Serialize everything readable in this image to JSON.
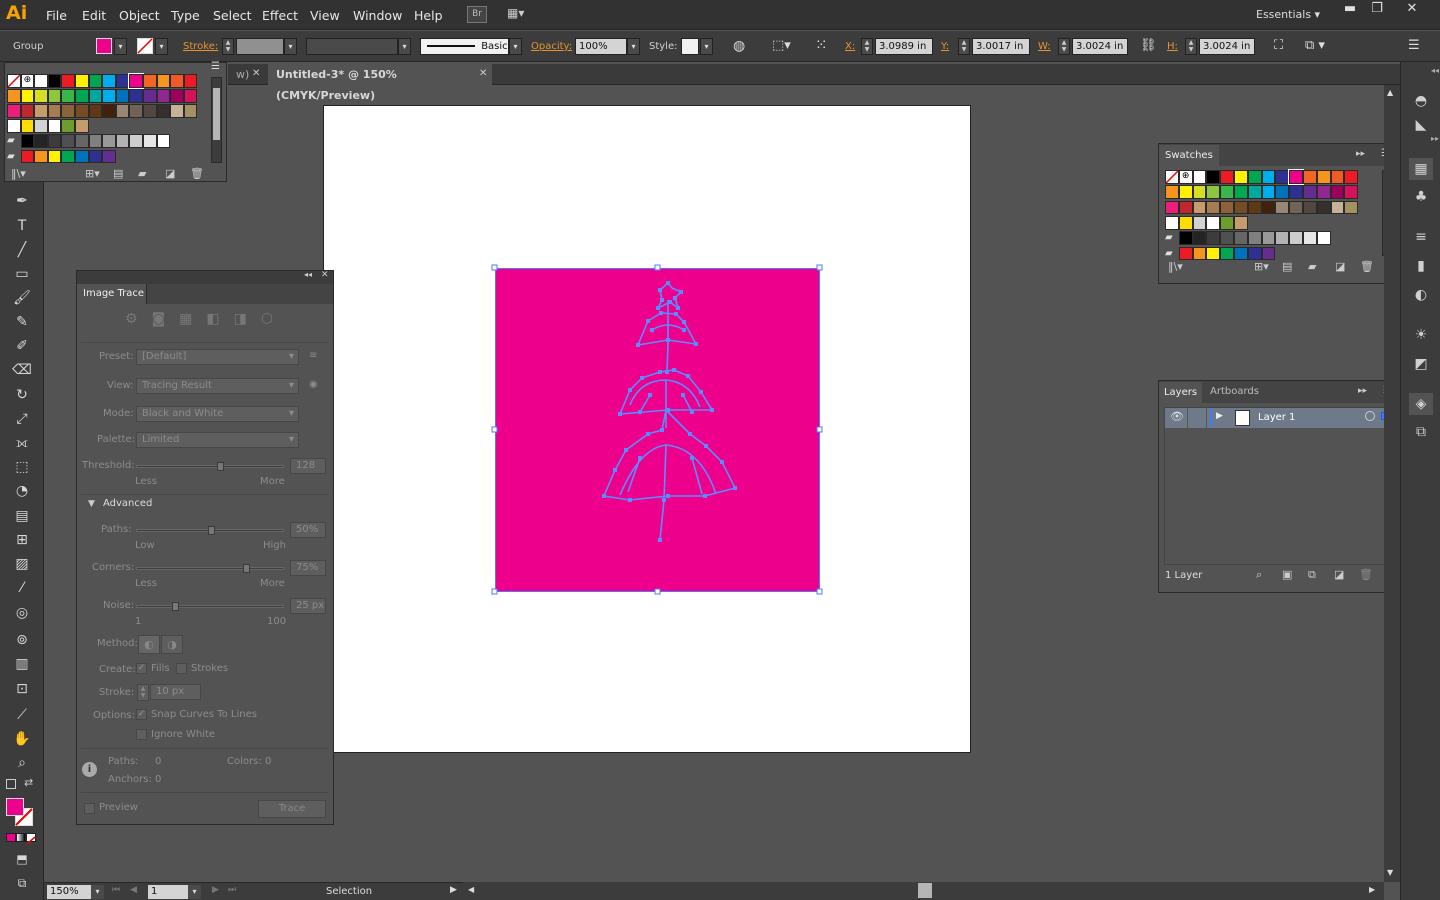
{
  "app": {
    "logo": "Ai",
    "workspace": "Essentials"
  },
  "menu": [
    "File",
    "Edit",
    "Object",
    "Type",
    "Select",
    "Effect",
    "View",
    "Window",
    "Help"
  ],
  "control": {
    "selection_type": "Group",
    "stroke_label": "Stroke:",
    "brush_label": "Basic",
    "opacity_label": "Opacity:",
    "opacity_value": "100%",
    "style_label": "Style:",
    "x_label": "X:",
    "x_value": "3.0989 in",
    "y_label": "Y:",
    "y_value": "3.0017 in",
    "w_label": "W:",
    "w_value": "3.0024 in",
    "h_label": "H:",
    "h_value": "3.0024 in",
    "fill_color": "#ec008c"
  },
  "tabs": {
    "prev_tab": "w)",
    "active_tab": "Untitled-3* @ 150% (CMYK/Preview)"
  },
  "status": {
    "zoom": "150%",
    "artboard_num": "1",
    "tool": "Selection"
  },
  "swatches_panel": {
    "title": "Swatches"
  },
  "layers_panel": {
    "tab_layers": "Layers",
    "tab_artboards": "Artboards",
    "layer_name": "Layer 1",
    "footer": "1 Layer"
  },
  "image_trace": {
    "title": "Image Trace",
    "preset_label": "Preset:",
    "preset_value": "[Default]",
    "view_label": "View:",
    "view_value": "Tracing Result",
    "mode_label": "Mode:",
    "mode_value": "Black and White",
    "palette_label": "Palette:",
    "palette_value": "Limited",
    "threshold_label": "Threshold:",
    "threshold_value": "128",
    "threshold_level": 0.57,
    "less": "Less",
    "more": "More",
    "advanced_label": "Advanced",
    "paths_label": "Paths:",
    "paths_value": "50%",
    "paths_level": 0.5,
    "low": "Low",
    "high": "High",
    "corners_label": "Corners:",
    "corners_value": "75%",
    "corners_level": 0.75,
    "noise_label": "Noise:",
    "noise_value": "25 px",
    "noise_level": 0.25,
    "noise_min": "1",
    "noise_max": "100",
    "method_label": "Method:",
    "create_label": "Create:",
    "fills_label": "Fills",
    "strokes_label": "Strokes",
    "stroke_label": "Stroke:",
    "stroke_value": "10 px",
    "options_label": "Options:",
    "snap_label": "Snap Curves To Lines",
    "ignore_white_label": "Ignore White",
    "info_paths_label": "Paths:",
    "info_paths_value": "0",
    "info_colors_label": "Colors:",
    "info_colors_value": "0",
    "info_anchors_label": "Anchors:",
    "info_anchors_value": "0",
    "preview_label": "Preview",
    "trace_button": "Trace"
  }
}
